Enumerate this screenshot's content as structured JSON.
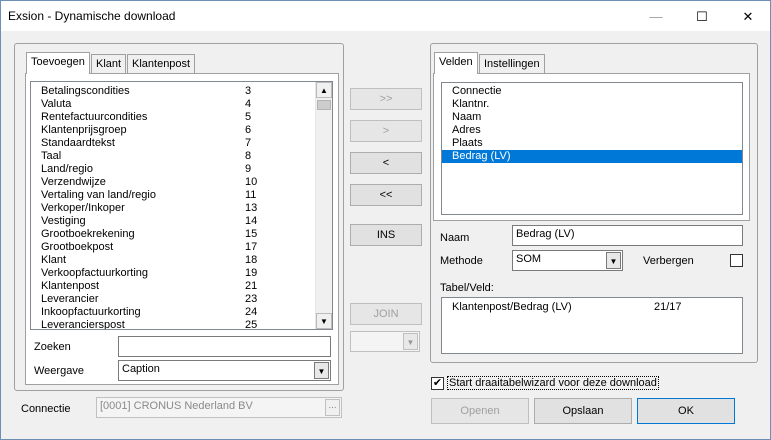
{
  "window": {
    "title": "Exsion - Dynamische download",
    "minimize": "—",
    "maximize": "☐",
    "close": "✕"
  },
  "left_tabs": [
    "Toevoegen",
    "Klant",
    "Klantenpost"
  ],
  "available_fields": [
    {
      "name": "Betalingscondities",
      "num": "3"
    },
    {
      "name": "Valuta",
      "num": "4"
    },
    {
      "name": "Rentefactuurcondities",
      "num": "5"
    },
    {
      "name": "Klantenprijsgroep",
      "num": "6"
    },
    {
      "name": "Standaardtekst",
      "num": "7"
    },
    {
      "name": "Taal",
      "num": "8"
    },
    {
      "name": "Land/regio",
      "num": "9"
    },
    {
      "name": "Verzendwijze",
      "num": "10"
    },
    {
      "name": "Vertaling van land/regio",
      "num": "11"
    },
    {
      "name": "Verkoper/Inkoper",
      "num": "13"
    },
    {
      "name": "Vestiging",
      "num": "14"
    },
    {
      "name": "Grootboekrekening",
      "num": "15"
    },
    {
      "name": "Grootboekpost",
      "num": "17"
    },
    {
      "name": "Klant",
      "num": "18"
    },
    {
      "name": "Verkoopfactuurkorting",
      "num": "19"
    },
    {
      "name": "Klantenpost",
      "num": "21"
    },
    {
      "name": "Leverancier",
      "num": "23"
    },
    {
      "name": "Inkoopfactuurkorting",
      "num": "24"
    },
    {
      "name": "Leverancierspost",
      "num": "25"
    }
  ],
  "search": {
    "label": "Zoeken",
    "value": ""
  },
  "display": {
    "label": "Weergave",
    "value": "Caption"
  },
  "connection": {
    "label": "Connectie",
    "value": "[0001] CRONUS Nederland BV",
    "browse": "..."
  },
  "move_buttons": {
    "add_all": ">>",
    "add": ">",
    "remove": "<",
    "remove_all": "<<",
    "ins": "INS",
    "join": "JOIN"
  },
  "right_tabs": [
    "Velden",
    "Instellingen"
  ],
  "selected_fields": [
    "Connectie",
    "Klantnr.",
    "Naam",
    "Adres",
    "Plaats",
    "Bedrag (LV)"
  ],
  "selected_index": 5,
  "naam": {
    "label": "Naam",
    "value": "Bedrag (LV)"
  },
  "methode": {
    "label": "Methode",
    "value": "SOM"
  },
  "verbergen": {
    "label": "Verbergen",
    "checked": false
  },
  "tabel_veld": {
    "label": "Tabel/Veld:",
    "rows": [
      {
        "name": "Klantenpost/Bedrag (LV)",
        "ref": "21/17"
      }
    ]
  },
  "pivot": {
    "label": "Start draaitabelwizard voor deze download",
    "checked": true,
    "mark": "✔"
  },
  "footer": {
    "open": "Openen",
    "save": "Opslaan",
    "ok": "OK"
  }
}
